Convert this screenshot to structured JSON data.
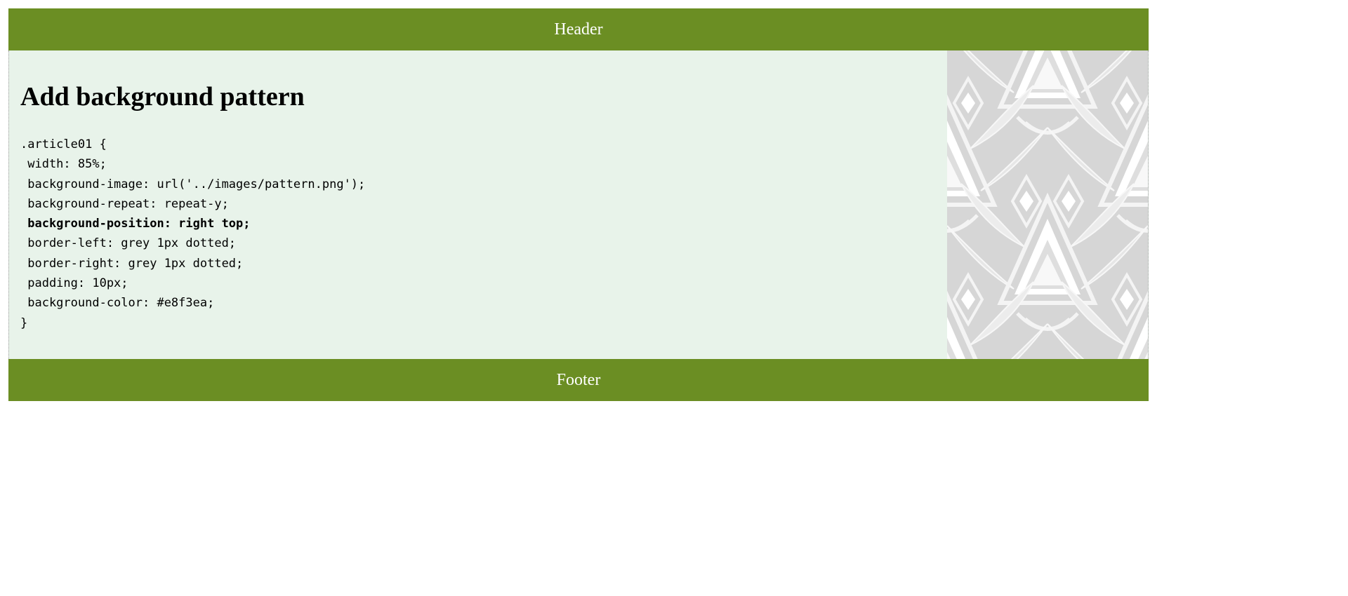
{
  "header": {
    "label": "Header"
  },
  "footer": {
    "label": "Footer"
  },
  "article": {
    "title": "Add background pattern",
    "code_lines": [
      {
        "text": ".article01 {",
        "bold": false
      },
      {
        "text": " width: 85%;",
        "bold": false
      },
      {
        "text": " background-image: url('../images/pattern.png');",
        "bold": false
      },
      {
        "text": " background-repeat: repeat-y;",
        "bold": false
      },
      {
        "text": " background-position: right top;",
        "bold": true
      },
      {
        "text": " border-left: grey 1px dotted;",
        "bold": false
      },
      {
        "text": " border-right: grey 1px dotted;",
        "bold": false
      },
      {
        "text": " padding: 10px;",
        "bold": false
      },
      {
        "text": " background-color: #e8f3ea;",
        "bold": false
      },
      {
        "text": "}",
        "bold": false
      }
    ],
    "pattern_image": "decorative-pattern"
  },
  "colors": {
    "header_bg": "#6b8e23",
    "footer_bg": "#6b8e23",
    "article_bg": "#e8f3ea",
    "pattern_bg": "#d6d6d6",
    "pattern_fg": "#f2f2f2"
  }
}
